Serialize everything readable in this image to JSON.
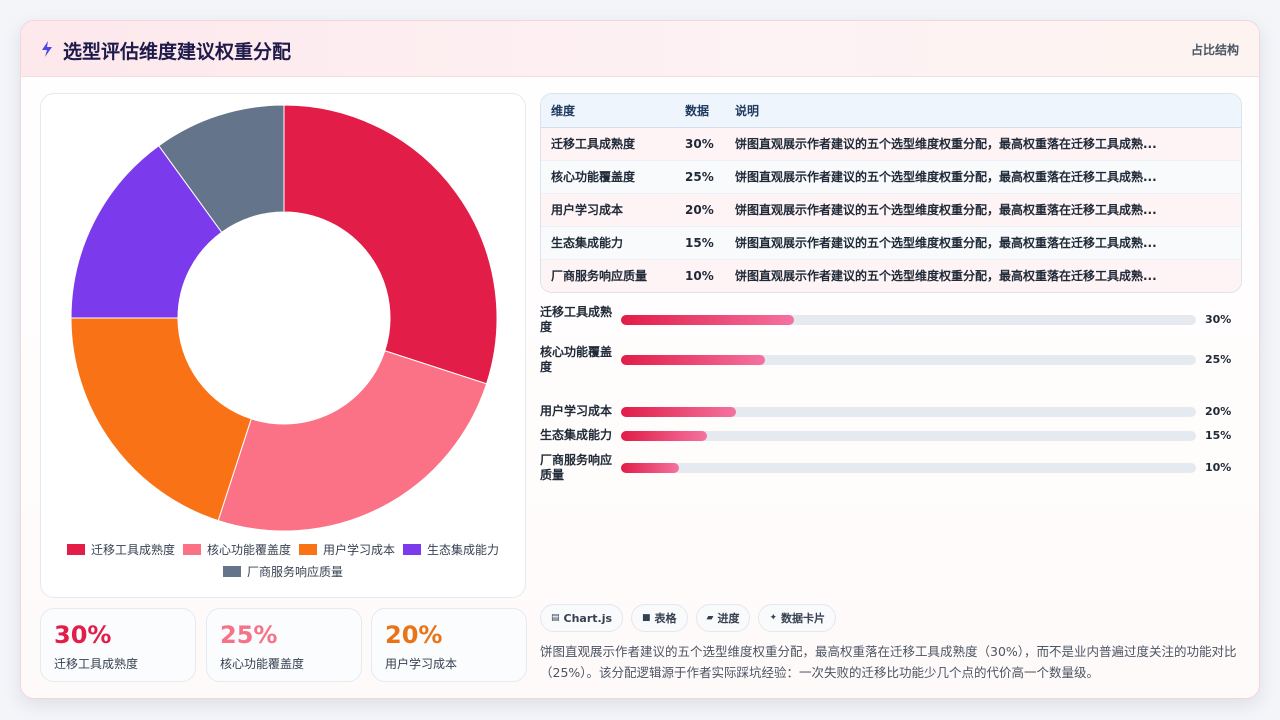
{
  "header": {
    "title": "选型评估维度建议权重分配",
    "tag": "占比结构"
  },
  "chart_data": {
    "type": "pie",
    "categories": [
      "迁移工具成熟度",
      "核心功能覆盖度",
      "用户学习成本",
      "生态集成能力",
      "厂商服务响应质量"
    ],
    "values": [
      30,
      25,
      20,
      15,
      10
    ],
    "unit": "%",
    "colors": [
      "#e11d48",
      "#fb7185",
      "#f97316",
      "#7c3aed",
      "#64748b"
    ],
    "legend_position": "bottom"
  },
  "stats": [
    {
      "value": "30%",
      "label": "迁移工具成熟度",
      "color": "#e11d48"
    },
    {
      "value": "25%",
      "label": "核心功能覆盖度",
      "color": "#f47387"
    },
    {
      "value": "20%",
      "label": "用户学习成本",
      "color": "#ea7317"
    }
  ],
  "table": {
    "headers": [
      "维度",
      "数据",
      "说明"
    ],
    "rows": [
      [
        "迁移工具成熟度",
        "30%",
        "饼图直观展示作者建议的五个选型维度权重分配，最高权重落在迁移工具成熟..."
      ],
      [
        "核心功能覆盖度",
        "25%",
        "饼图直观展示作者建议的五个选型维度权重分配，最高权重落在迁移工具成熟..."
      ],
      [
        "用户学习成本",
        "20%",
        "饼图直观展示作者建议的五个选型维度权重分配，最高权重落在迁移工具成熟..."
      ],
      [
        "生态集成能力",
        "15%",
        "饼图直观展示作者建议的五个选型维度权重分配，最高权重落在迁移工具成熟..."
      ],
      [
        "厂商服务响应质量",
        "10%",
        "饼图直观展示作者建议的五个选型维度权重分配，最高权重落在迁移工具成熟..."
      ]
    ]
  },
  "progress": [
    {
      "label": "迁移工具成熟度",
      "value": 30,
      "text": "30%"
    },
    {
      "label": "核心功能覆盖度",
      "value": 25,
      "text": "25%"
    },
    {
      "label": "用户学习成本",
      "value": 20,
      "text": "20%"
    },
    {
      "label": "生态集成能力",
      "value": 15,
      "text": "15%"
    },
    {
      "label": "厂商服务响应质量",
      "value": 10,
      "text": "10%"
    }
  ],
  "pills": [
    {
      "icon": "▤",
      "icon_name": "chart-icon",
      "label": "Chart.js"
    },
    {
      "icon": "■",
      "icon_name": "table-icon",
      "label": "表格"
    },
    {
      "icon": "▰",
      "icon_name": "progress-icon",
      "label": "进度"
    },
    {
      "icon": "✦",
      "icon_name": "sparkle-icon",
      "label": "数据卡片"
    }
  ],
  "description": "饼图直观展示作者建议的五个选型维度权重分配，最高权重落在迁移工具成熟度（30%），而不是业内普遍过度关注的功能对比（25%）。该分配逻辑源于作者实际踩坑经验：一次失败的迁移比功能少几个点的代价高一个数量级。"
}
